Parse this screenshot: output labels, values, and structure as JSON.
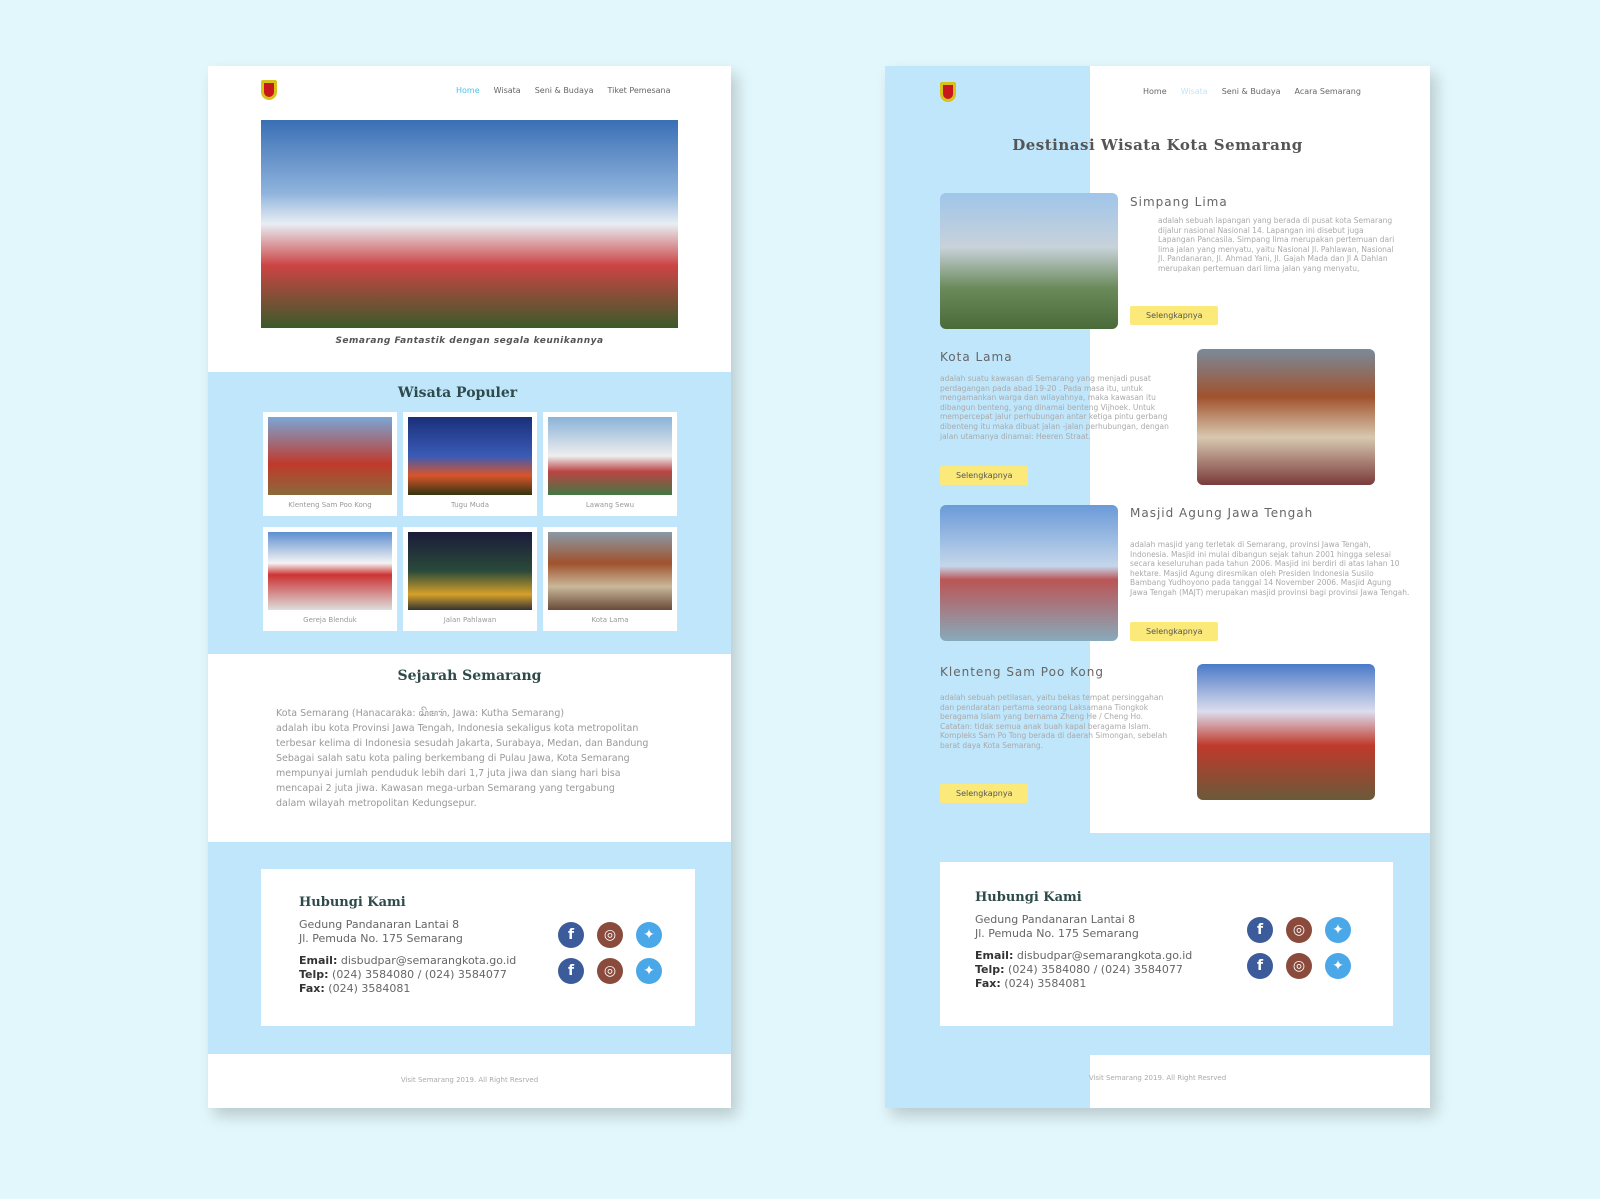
{
  "left": {
    "nav": [
      "Home",
      "Wisata",
      "Seni & Budaya",
      "Tiket Pemesana"
    ],
    "tagline": "Semarang Fantastik dengan segala keunikannya",
    "popular_title": "Wisata Populer",
    "popular": [
      "Klenteng Sam Poo Kong",
      "Tugu Muda",
      "Lawang Sewu",
      "Gereja Blenduk",
      "Jalan Pahlawan",
      "Kota Lama"
    ],
    "history_title": "Sejarah Semarang",
    "history": [
      "Kota Semarang (Hanacaraka: ꦱꦼꦩꦫꦁ, Jawa: Kutha Semarang)",
      "adalah ibu kota Provinsi Jawa Tengah, Indonesia sekaligus kota metropolitan",
      "terbesar kelima di Indonesia sesudah Jakarta, Surabaya, Medan, dan Bandung",
      "Sebagai salah satu kota paling berkembang di Pulau Jawa, Kota Semarang",
      "mempunyai jumlah penduduk lebih dari 1,7 juta jiwa dan siang hari bisa",
      "mencapai 2 juta jiwa. Kawasan mega-urban Semarang yang tergabung",
      "dalam wilayah metropolitan Kedungsepur."
    ],
    "footer": "Visit Semarang 2019. All Right Resrved"
  },
  "contact": {
    "title": "Hubungi Kami",
    "address1": "Gedung Pandanaran Lantai 8",
    "address2": "Jl. Pemuda No. 175 Semarang",
    "email_label": "Email:",
    "email": "disbudpar@semarangkota.go.id",
    "telp_label": "Telp:",
    "telp": "(024) 3584080 / (024) 3584077",
    "fax_label": "Fax:",
    "fax": "(024) 3584081"
  },
  "right": {
    "nav": [
      "Home",
      "Wisata",
      "Seni & Budaya",
      "Acara Semarang"
    ],
    "title": "Destinasi Wisata Kota Semarang",
    "button": "Selengkapnya",
    "destinations": [
      {
        "name": "Simpang Lima",
        "text": "adalah sebuah lapangan yang berada di pusat kota Semarang dijalur nasional Nasional 14. Lapangan ini disebut juga Lapangan Pancasila. Simpang lima merupakan pertemuan dari lima jalan yang menyatu, yaitu Nasional Jl. Pahlawan, Nasional Jl. Pandanaran, Jl. Ahmad Yani, Jl. Gajah Mada dan Jl A Dahlan merupakan pertemuan dari lima jalan yang menyatu,"
      },
      {
        "name": "Kota Lama",
        "text": "adalah suatu kawasan di Semarang yang menjadi pusat perdagangan pada abad 19-20 . Pada masa itu, untuk mengamankan warga dan wilayahnya, maka kawasan itu dibangun benteng, yang dinamai benteng Vijhoek. Untuk mempercepat jalur perhubungan antar ketiga pintu gerbang dibenteng itu maka dibuat jalan -jalan perhubungan, dengan jalan utamanya dinamai: Heeren Straat."
      },
      {
        "name": "Masjid Agung Jawa Tengah",
        "text": "adalah masjid yang terletak di Semarang, provinsi Jawa Tengah, Indonesia. Masjid ini mulai dibangun sejak tahun 2001 hingga selesai secara keseluruhan pada tahun 2006. Masjid ini berdiri di atas lahan 10 hektare. Masjid Agung diresmikan oleh Presiden Indonesia Susilo Bambang Yudhoyono pada tanggal 14 November 2006. Masjid Agung Jawa Tengah (MAJT) merupakan masjid provinsi bagi provinsi Jawa Tengah."
      },
      {
        "name": "Klenteng Sam Poo Kong",
        "text": "adalah sebuah petilasan, yaitu bekas tempat persinggahan dan pendaratan pertama seorang Laksamana Tiongkok beragama Islam yang bernama Zheng He / Cheng Ho. Catatan: tidak semua anak buah kapal beragama Islam. Kompleks Sam Po Tong berada di daerah Simongan, sebelah barat daya Kota Semarang."
      }
    ],
    "footer": "Visit Semarang 2019. All Right Resrved"
  }
}
